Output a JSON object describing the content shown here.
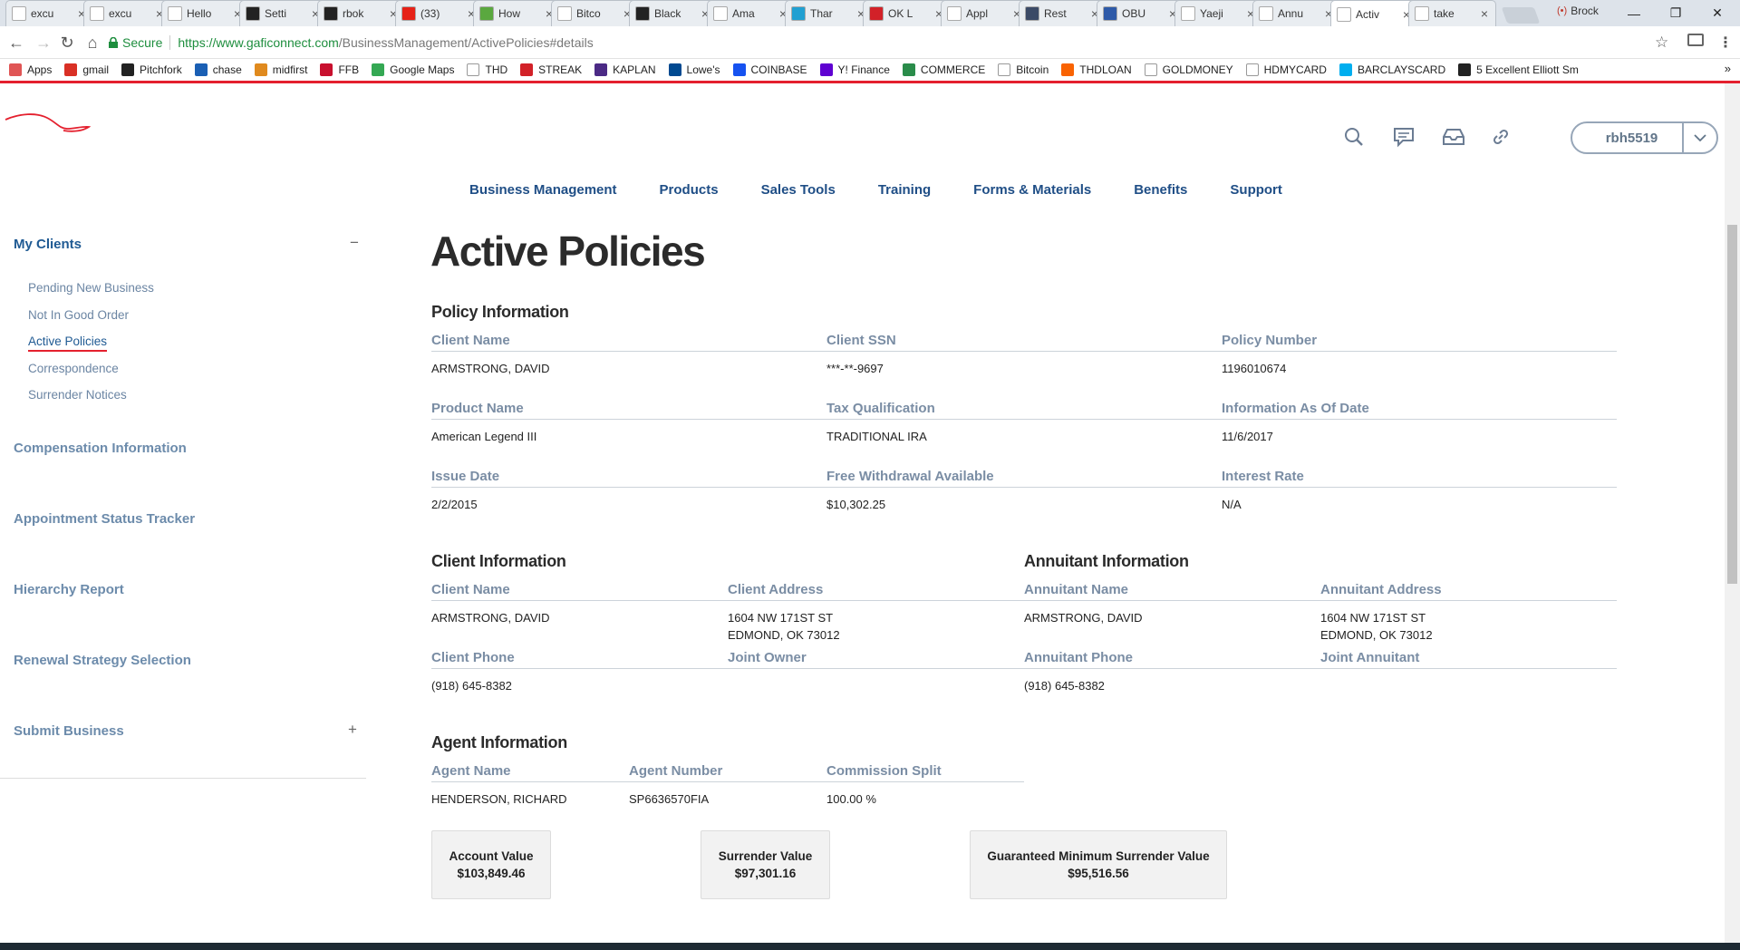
{
  "browser": {
    "tabs": [
      {
        "title": "excu",
        "icon": "document-icon",
        "color": "#ffffff"
      },
      {
        "title": "excu",
        "icon": "document-icon",
        "color": "#ffffff"
      },
      {
        "title": "Hello",
        "icon": "document-icon",
        "color": "#ffffff"
      },
      {
        "title": "Setti",
        "icon": "github-icon",
        "color": "#222222"
      },
      {
        "title": "rbok",
        "icon": "github-icon",
        "color": "#222222"
      },
      {
        "title": "(33)",
        "icon": "youtube-icon",
        "color": "#e62117"
      },
      {
        "title": "How",
        "icon": "w-icon",
        "color": "#5aa83f"
      },
      {
        "title": "Bitco",
        "icon": "reddit-icon",
        "color": "#ffffff"
      },
      {
        "title": "Black",
        "icon": "b-icon",
        "color": "#222222"
      },
      {
        "title": "Ama",
        "icon": "amazon-icon",
        "color": "#ffffff"
      },
      {
        "title": "Thar",
        "icon": "wp-icon",
        "color": "#21a0d2"
      },
      {
        "title": "OK L",
        "icon": "ok-icon",
        "color": "#d22128"
      },
      {
        "title": "Appl",
        "icon": "reddit-icon",
        "color": "#ffffff"
      },
      {
        "title": "Rest",
        "icon": "f-icon",
        "color": "#3b4a66"
      },
      {
        "title": "OBU",
        "icon": "circle-icon",
        "color": "#2e5aa8"
      },
      {
        "title": "Yaeji",
        "icon": "pitchfork-icon",
        "color": "#ffffff"
      },
      {
        "title": "Annu",
        "icon": "swoosh-icon",
        "color": "#ffffff"
      },
      {
        "title": "Activ",
        "icon": "swoosh-icon",
        "color": "#ffffff",
        "active": true
      },
      {
        "title": "take",
        "icon": "google-icon",
        "color": "#ffffff"
      }
    ],
    "profile_name": "Brock",
    "secure_label": "Secure",
    "url_host": "https://www.gaficonnect.com",
    "url_path": "/BusinessManagement/ActivePolicies#details",
    "bookmarks": [
      {
        "label": "Apps",
        "icon": "apps-icon",
        "color": "#e05555"
      },
      {
        "label": "gmail",
        "icon": "gmail-icon",
        "color": "#d93025"
      },
      {
        "label": "Pitchfork",
        "icon": "pitchfork-icon",
        "color": "#222222"
      },
      {
        "label": "chase",
        "icon": "chase-icon",
        "color": "#1a5fb4"
      },
      {
        "label": "midfirst",
        "icon": "midfirst-icon",
        "color": "#e08a1e"
      },
      {
        "label": "FFB",
        "icon": "ffb-icon",
        "color": "#c8102e"
      },
      {
        "label": "Google Maps",
        "icon": "maps-icon",
        "color": "#34a853"
      },
      {
        "label": "THD",
        "icon": "document-icon",
        "color": "#ffffff"
      },
      {
        "label": "STREAK",
        "icon": "streak-icon",
        "color": "#d22128"
      },
      {
        "label": "KAPLAN",
        "icon": "kaplan-icon",
        "color": "#4b2a85"
      },
      {
        "label": "Lowe's",
        "icon": "lowes-icon",
        "color": "#004990"
      },
      {
        "label": "COINBASE",
        "icon": "coinbase-icon",
        "color": "#1652f0"
      },
      {
        "label": "Y! Finance",
        "icon": "yahoo-icon",
        "color": "#5f01d1"
      },
      {
        "label": "COMMERCE",
        "icon": "globe-icon",
        "color": "#2a8c4a"
      },
      {
        "label": "Bitcoin",
        "icon": "reddit-icon",
        "color": "#ffffff"
      },
      {
        "label": "THDLOAN",
        "icon": "homedepot-icon",
        "color": "#f96302"
      },
      {
        "label": "GOLDMONEY",
        "icon": "document-icon",
        "color": "#ffffff"
      },
      {
        "label": "HDMYCARD",
        "icon": "document-icon",
        "color": "#ffffff"
      },
      {
        "label": "BARCLAYSCARD",
        "icon": "barclays-icon",
        "color": "#00aeef"
      },
      {
        "label": "5 Excellent Elliott Sm",
        "icon": "pitchfork-icon",
        "color": "#222222"
      }
    ]
  },
  "header": {
    "username": "rbh5519",
    "icons": [
      "search-icon",
      "chat-icon",
      "inbox-icon",
      "link-icon"
    ]
  },
  "nav": [
    "Business Management",
    "Products",
    "Sales Tools",
    "Training",
    "Forms & Materials",
    "Benefits",
    "Support"
  ],
  "sidebar": {
    "my_clients": "My Clients",
    "my_clients_toggle": "−",
    "sub_items": [
      "Pending New Business",
      "Not In Good Order",
      "Active Policies",
      "Correspondence",
      "Surrender Notices"
    ],
    "compensation": "Compensation Information",
    "appointment": "Appointment Status Tracker",
    "hierarchy": "Hierarchy Report",
    "renewal": "Renewal Strategy Selection",
    "submit": "Submit Business",
    "submit_toggle": "+"
  },
  "page": {
    "title": "Active Policies",
    "policy": {
      "section_title": "Policy Information",
      "client_name_label": "Client Name",
      "client_name": "ARMSTRONG, DAVID",
      "client_ssn_label": "Client SSN",
      "client_ssn": "***-**-9697",
      "policy_number_label": "Policy Number",
      "policy_number": "1196010674",
      "product_name_label": "Product Name",
      "product_name": "American Legend III",
      "tax_qual_label": "Tax Qualification",
      "tax_qual": "TRADITIONAL IRA",
      "info_date_label": "Information As Of Date",
      "info_date": "11/6/2017",
      "issue_date_label": "Issue Date",
      "issue_date": "2/2/2015",
      "free_withdrawal_label": "Free Withdrawal Available",
      "free_withdrawal": "$10,302.25",
      "interest_rate_label": "Interest Rate",
      "interest_rate": "N/A"
    },
    "client": {
      "section_title": "Client Information",
      "name_label": "Client Name",
      "name": "ARMSTRONG, DAVID",
      "address_label": "Client Address",
      "address_line1": "1604 NW 171ST ST",
      "address_line2": "EDMOND, OK 73012",
      "phone_label": "Client Phone",
      "phone": "(918) 645-8382",
      "joint_label": "Joint Owner",
      "joint": ""
    },
    "annuitant": {
      "section_title": "Annuitant Information",
      "name_label": "Annuitant Name",
      "name": "ARMSTRONG, DAVID",
      "address_label": "Annuitant Address",
      "address_line1": "1604 NW 171ST ST",
      "address_line2": "EDMOND, OK 73012",
      "phone_label": "Annuitant Phone",
      "phone": "(918) 645-8382",
      "joint_label": "Joint Annuitant",
      "joint": ""
    },
    "agent": {
      "section_title": "Agent Information",
      "name_label": "Agent Name",
      "name": "HENDERSON, RICHARD",
      "number_label": "Agent Number",
      "number": "SP6636570FIA",
      "split_label": "Commission Split",
      "split": "100.00 %"
    },
    "values": {
      "account_label": "Account Value",
      "account": "$103,849.46",
      "surrender_label": "Surrender Value",
      "surrender": "$97,301.16",
      "guaranteed_label": "Guaranteed Minimum Surrender Value",
      "guaranteed": "$95,516.56"
    }
  },
  "colors": {
    "brand_red": "#e4202e",
    "nav_blue": "#1f4e86",
    "label_grey_blue": "#7a8da4"
  }
}
